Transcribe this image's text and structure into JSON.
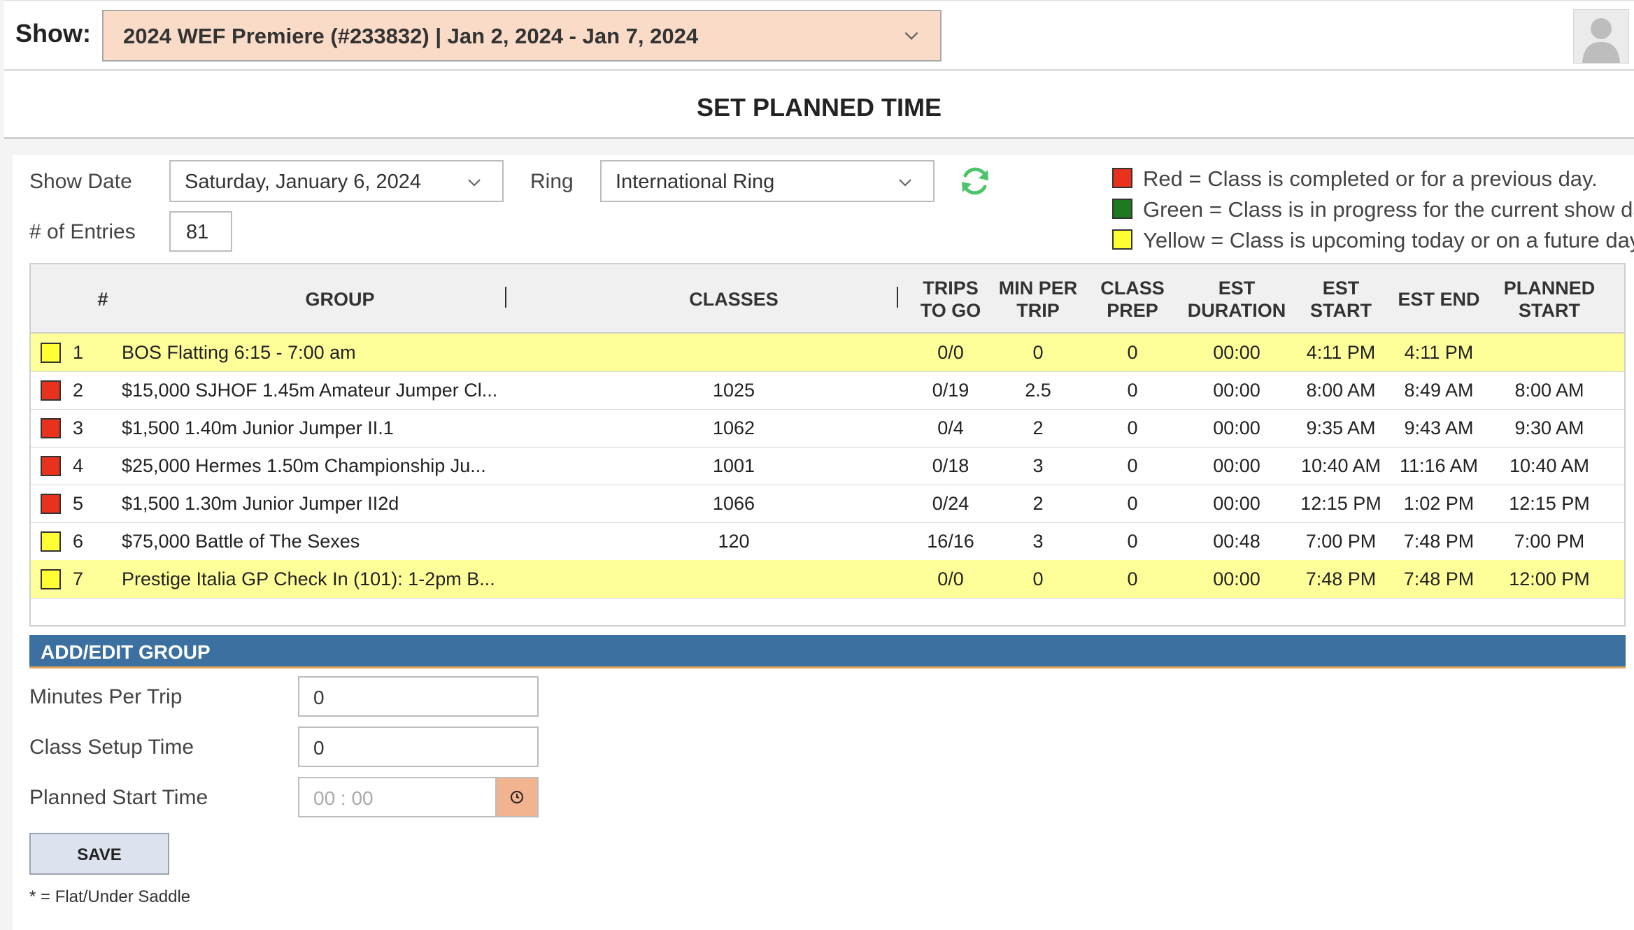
{
  "header": {
    "show_label": "Show:",
    "show_select_value": "2024 WEF Premiere (#233832) | Jan 2, 2024 - Jan 7, 2024",
    "title": "SET PLANNED TIME"
  },
  "filters": {
    "show_date_label": "Show Date",
    "show_date_value": "Saturday, January 6, 2024",
    "ring_label": "Ring",
    "ring_value": "International Ring",
    "entries_label": "# of Entries",
    "entries_value": "81"
  },
  "legend": [
    {
      "color": "#e8321e",
      "text": "Red = Class is completed or for a previous day."
    },
    {
      "color": "#1e7a1e",
      "text": "Green = Class is in progress for the current show day."
    },
    {
      "color": "#ffff33",
      "text": "Yellow = Class is upcoming today or on a future day."
    }
  ],
  "table": {
    "headers": {
      "num": "#",
      "group": "GROUP",
      "classes": "CLASSES",
      "trips_to_go": "TRIPS TO GO",
      "min_per_trip": "MIN PER TRIP",
      "class_prep": "CLASS PREP",
      "est_duration": "EST DURATION",
      "est_start": "EST START",
      "est_end": "EST END",
      "planned_start": "PLANNED START"
    },
    "rows": [
      {
        "status": "yellow",
        "highlight": true,
        "num": "1",
        "group": "BOS Flatting 6:15 - 7:00 am",
        "classes": "",
        "trips": "0/0",
        "min_per_trip": "0",
        "prep": "0",
        "duration": "00:00",
        "est_start": "4:11 PM",
        "est_end": "4:11 PM",
        "planned_start": ""
      },
      {
        "status": "red",
        "highlight": false,
        "num": "2",
        "group": "$15,000 SJHOF 1.45m Amateur Jumper Cl...",
        "classes": "1025",
        "trips": "0/19",
        "min_per_trip": "2.5",
        "prep": "0",
        "duration": "00:00",
        "est_start": "8:00 AM",
        "est_end": "8:49 AM",
        "planned_start": "8:00 AM"
      },
      {
        "status": "red",
        "highlight": false,
        "num": "3",
        "group": "$1,500 1.40m Junior Jumper II.1",
        "classes": "1062",
        "trips": "0/4",
        "min_per_trip": "2",
        "prep": "0",
        "duration": "00:00",
        "est_start": "9:35 AM",
        "est_end": "9:43 AM",
        "planned_start": "9:30 AM"
      },
      {
        "status": "red",
        "highlight": false,
        "num": "4",
        "group": "$25,000 Hermes 1.50m Championship Ju...",
        "classes": "1001",
        "trips": "0/18",
        "min_per_trip": "3",
        "prep": "0",
        "duration": "00:00",
        "est_start": "10:40 AM",
        "est_end": "11:16 AM",
        "planned_start": "10:40 AM"
      },
      {
        "status": "red",
        "highlight": false,
        "num": "5",
        "group": "$1,500 1.30m Junior Jumper II2d",
        "classes": "1066",
        "trips": "0/24",
        "min_per_trip": "2",
        "prep": "0",
        "duration": "00:00",
        "est_start": "12:15 PM",
        "est_end": "1:02 PM",
        "planned_start": "12:15 PM"
      },
      {
        "status": "yellow",
        "highlight": false,
        "num": "6",
        "group": "$75,000 Battle of The Sexes",
        "classes": "120",
        "trips": "16/16",
        "min_per_trip": "3",
        "prep": "0",
        "duration": "00:48",
        "est_start": "7:00 PM",
        "est_end": "7:48 PM",
        "planned_start": "7:00 PM"
      },
      {
        "status": "yellow",
        "highlight": true,
        "num": "7",
        "group": "Prestige Italia GP Check In (101): 1-2pm B...",
        "classes": "",
        "trips": "0/0",
        "min_per_trip": "0",
        "prep": "0",
        "duration": "00:00",
        "est_start": "7:48 PM",
        "est_end": "7:48 PM",
        "planned_start": "12:00 PM"
      }
    ]
  },
  "edit_group": {
    "title": "ADD/EDIT GROUP",
    "minutes_per_trip_label": "Minutes Per Trip",
    "minutes_per_trip_value": "0",
    "class_setup_label": "Class Setup Time",
    "class_setup_value": "0",
    "planned_start_label": "Planned Start Time",
    "planned_start_placeholder": "00 : 00",
    "save_label": "SAVE",
    "footnote": "* = Flat/Under Saddle"
  },
  "colors": {
    "red": "#e8321e",
    "green": "#1e7a1e",
    "yellow": "#ffff33",
    "row_highlight": "#ffff99",
    "section_bar": "#3b70a0",
    "accent_orange": "#f2b48f",
    "show_select_bg": "#f9dbc8",
    "refresh_icon": "#4cc46a"
  },
  "icons": {
    "refresh": "refresh-icon",
    "clock": "clock-icon",
    "avatar": "user-avatar-icon",
    "chevron": "chevron-down-icon"
  }
}
